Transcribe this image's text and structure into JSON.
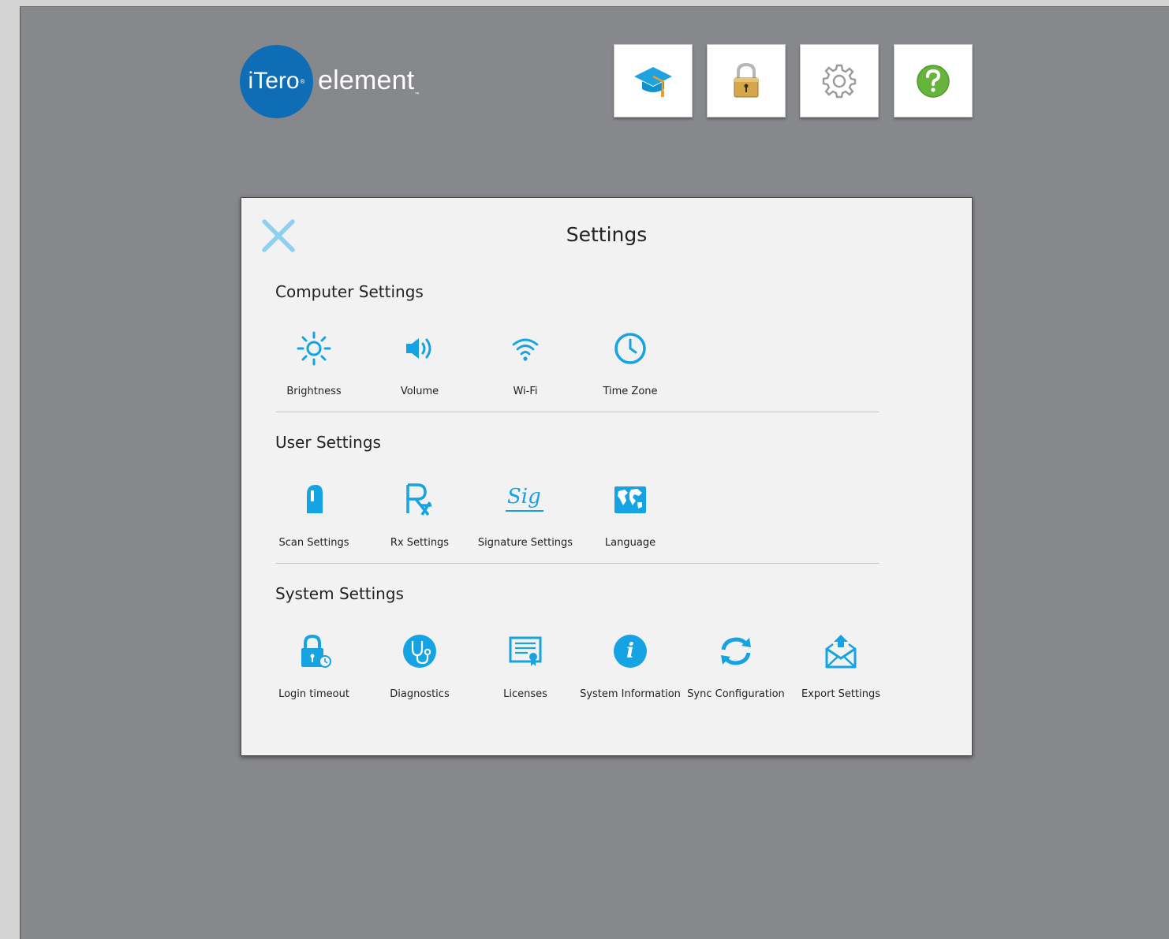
{
  "brand": {
    "logo_circle_text": "iTero",
    "logo_circle_mark": "®",
    "logo_word": "element",
    "logo_word_mark": "™"
  },
  "toolbar": [
    {
      "name": "training-button",
      "icon": "graduation-cap-icon"
    },
    {
      "name": "lock-button",
      "icon": "padlock-icon"
    },
    {
      "name": "settings-button",
      "icon": "gear-icon"
    },
    {
      "name": "help-button",
      "icon": "question-mark-icon"
    }
  ],
  "dialog": {
    "title": "Settings",
    "close_icon": "close-x-icon",
    "sections": [
      {
        "title": "Computer Settings",
        "items": [
          {
            "label": "Brightness",
            "icon": "brightness-sun-icon"
          },
          {
            "label": "Volume",
            "icon": "speaker-volume-icon"
          },
          {
            "label": "Wi-Fi",
            "icon": "wifi-icon"
          },
          {
            "label": "Time Zone",
            "icon": "clock-icon"
          }
        ]
      },
      {
        "title": "User Settings",
        "items": [
          {
            "label": "Scan Settings",
            "icon": "scanner-wand-icon"
          },
          {
            "label": "Rx Settings",
            "icon": "rx-icon"
          },
          {
            "label": "Signature Settings",
            "icon": "signature-icon",
            "glyph": "Sig"
          },
          {
            "label": "Language",
            "icon": "world-map-icon"
          }
        ]
      },
      {
        "title": "System Settings",
        "items": [
          {
            "label": "Login timeout",
            "icon": "lock-timer-icon"
          },
          {
            "label": "Diagnostics",
            "icon": "stethoscope-icon"
          },
          {
            "label": "Licenses",
            "icon": "certificate-icon"
          },
          {
            "label": "System Information",
            "icon": "info-icon",
            "glyph": "i"
          },
          {
            "label": "Sync Configuration",
            "icon": "sync-arrows-icon"
          },
          {
            "label": "Export Settings",
            "icon": "export-envelope-icon"
          }
        ]
      }
    ]
  },
  "colors": {
    "background": "#87888c",
    "logo_blue": "#0f6db6",
    "icon_blue": "#16a3e3",
    "close_blue": "#8fd0f0",
    "help_green": "#67b43c",
    "lock_gold": "#d6a64b"
  }
}
